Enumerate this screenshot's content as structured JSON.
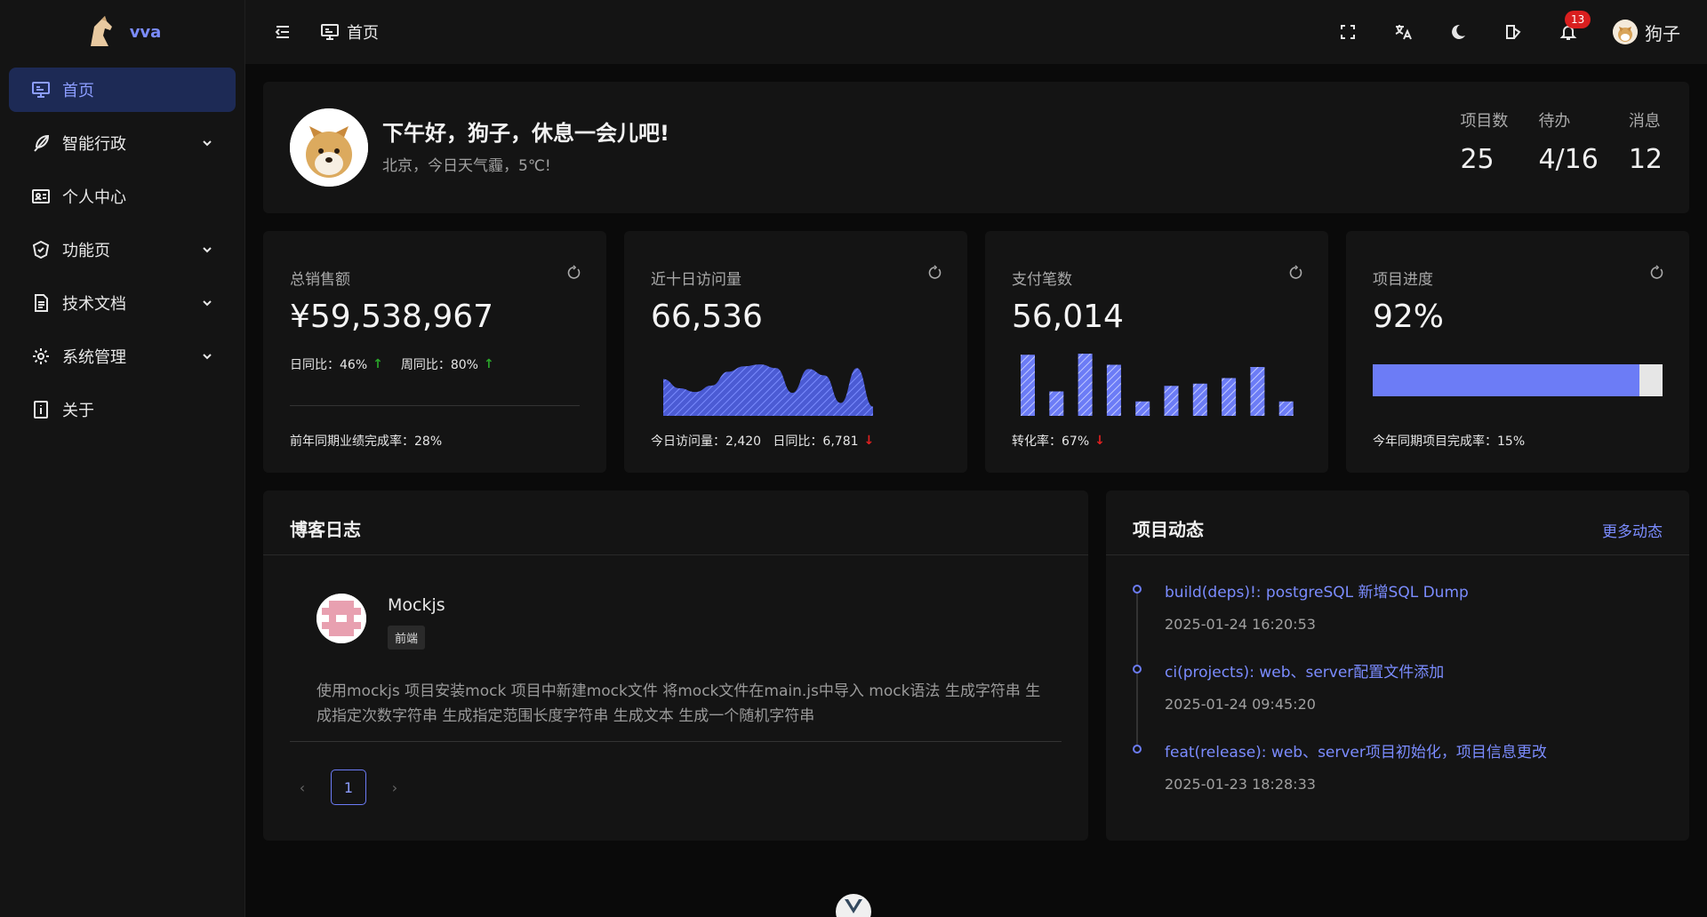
{
  "app": {
    "name": "vva"
  },
  "sidebar": {
    "items": [
      {
        "label": "首页",
        "icon": "monitor-icon",
        "active": true
      },
      {
        "label": "智能行政",
        "icon": "feather-icon",
        "expandable": true
      },
      {
        "label": "个人中心",
        "icon": "id-card-icon"
      },
      {
        "label": "功能页",
        "icon": "shield-icon",
        "expandable": true
      },
      {
        "label": "技术文档",
        "icon": "document-icon",
        "expandable": true
      },
      {
        "label": "系统管理",
        "icon": "gear-icon",
        "expandable": true
      },
      {
        "label": "关于",
        "icon": "info-icon"
      }
    ]
  },
  "header": {
    "breadcrumb": "首页",
    "notification_count": "13",
    "username": "狗子"
  },
  "welcome": {
    "title": "下午好，狗子，休息一会儿吧!",
    "subtitle": "北京，今日天气霾，5℃!",
    "stats": [
      {
        "label": "项目数",
        "value": "25"
      },
      {
        "label": "待办",
        "value": "4/16"
      },
      {
        "label": "消息",
        "value": "12"
      }
    ]
  },
  "kpis": {
    "sales": {
      "title": "总销售额",
      "value": "¥59,538,967",
      "daily": "日同比：46%",
      "weekly": "周同比：80%",
      "footer": "前年同期业绩完成率：28%"
    },
    "visits": {
      "title": "近十日访问量",
      "value": "66,536",
      "footer": "今日访问量：2,420   日同比：6,781"
    },
    "payments": {
      "title": "支付笔数",
      "value": "56,014",
      "footer": "转化率：67%"
    },
    "progress": {
      "title": "项目进度",
      "value": "92%",
      "fill": 0.92,
      "footer": "今年同期项目完成率：15%"
    }
  },
  "chart_data": [
    {
      "type": "area",
      "values": [
        4,
        3,
        2.6,
        3.3,
        4.8,
        5.4,
        5.6,
        5.2,
        2.5,
        5.1,
        4.4,
        1.4,
        5.2,
        1.0
      ],
      "title": "",
      "xlabel": "",
      "ylabel": ""
    },
    {
      "type": "bar",
      "values": [
        5.5,
        2.2,
        5.6,
        4.6,
        1.3,
        2.7,
        2.9,
        3.4,
        4.4,
        1.3
      ],
      "title": "",
      "xlabel": "",
      "ylabel": ""
    }
  ],
  "blog": {
    "title": "博客日志",
    "entry": {
      "author": "Mockjs",
      "tag": "前端",
      "body": "使用mockjs 项目安装mock 项目中新建mock文件 将mock文件在main.js中导入 mock语法 生成字符串 生成指定次数字符串 生成指定范围长度字符串 生成文本 生成一个随机字符串"
    },
    "page": "1",
    "prev": "‹",
    "next": "›"
  },
  "activity": {
    "title": "项目动态",
    "more": "更多动态",
    "items": [
      {
        "title": "build(deps)!: postgreSQL 新增SQL Dump",
        "time": "2025-01-24 16:20:53"
      },
      {
        "title": "ci(projects): web、server配置文件添加",
        "time": "2025-01-24 09:45:20"
      },
      {
        "title": "feat(release): web、server项目初始化，项目信息更改",
        "time": "2025-01-23 18:28:33"
      }
    ]
  },
  "colors": {
    "accent": "#6c7cf6",
    "up": "#2aa52a",
    "down": "#e02020"
  }
}
